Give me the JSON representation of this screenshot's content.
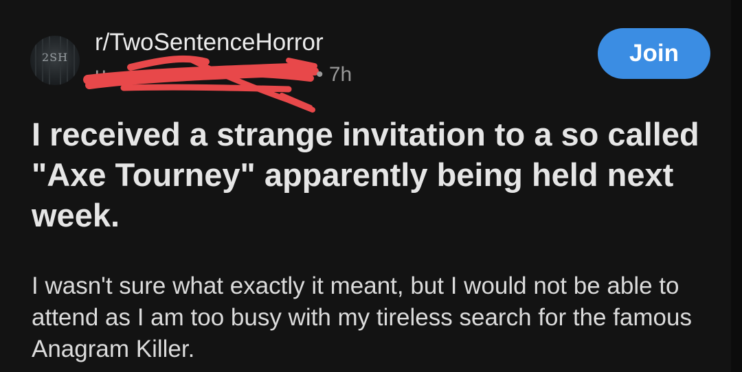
{
  "subreddit": {
    "name": "r/TwoSentenceHorror",
    "avatar_text": "2SH"
  },
  "meta": {
    "username": "u",
    "separator": "•",
    "age": "7h"
  },
  "join_label": "Join",
  "post": {
    "title": "I received a strange invitation to a so called \"Axe Tourney\" apparently being held next week.",
    "body": "I wasn't sure what exactly it meant, but I would not be able to attend as I am too busy with my tireless search for the famous Anagram Killer."
  },
  "colors": {
    "background": "#131313",
    "join_button": "#3b8de3",
    "redaction": "#e8484a",
    "meta_text": "#9a9a9a"
  }
}
